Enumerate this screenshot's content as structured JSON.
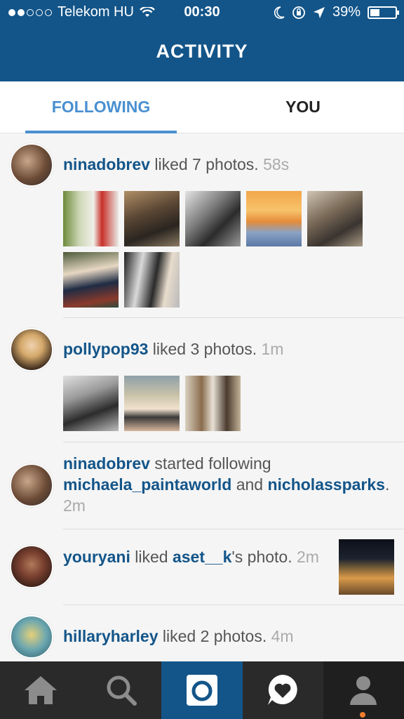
{
  "status_bar": {
    "carrier": "Telekom HU",
    "signal_dots_on": 2,
    "signal_dots_total": 5,
    "time": "00:30",
    "battery": "39%",
    "battery_level": 0.39
  },
  "header": {
    "title": "ACTIVITY"
  },
  "tabs": [
    {
      "label": "FOLLOWING",
      "active": true
    },
    {
      "label": "YOU",
      "active": false
    }
  ],
  "feed": [
    {
      "user": "ninadobrev",
      "action": " liked 7 photos. ",
      "time": "58s",
      "photos": 7
    },
    {
      "user": "pollypop93",
      "action": " liked 3 photos. ",
      "time": "1m",
      "photos": 3
    },
    {
      "user": "ninadobrev",
      "action": " started following ",
      "target1": "michaela_paintaworld",
      "conj": " and ",
      "target2": "nicholassparks",
      "end": ". ",
      "time": "2m"
    },
    {
      "user": "youryani",
      "action": " liked ",
      "target": "aset__k",
      "end": "'s photo. ",
      "time": "2m"
    },
    {
      "user": "hillaryharley",
      "action": " liked 2 photos. ",
      "time": "4m"
    }
  ],
  "tabbar": [
    {
      "name": "home-icon"
    },
    {
      "name": "search-icon"
    },
    {
      "name": "camera-icon"
    },
    {
      "name": "activity-heart-icon"
    },
    {
      "name": "profile-icon"
    }
  ],
  "colors": {
    "header_bg": "#135589",
    "accent": "#4a90d0",
    "username": "#135589",
    "tabbar_bg": "#2a2a2a",
    "notification": "#f07d2d"
  }
}
